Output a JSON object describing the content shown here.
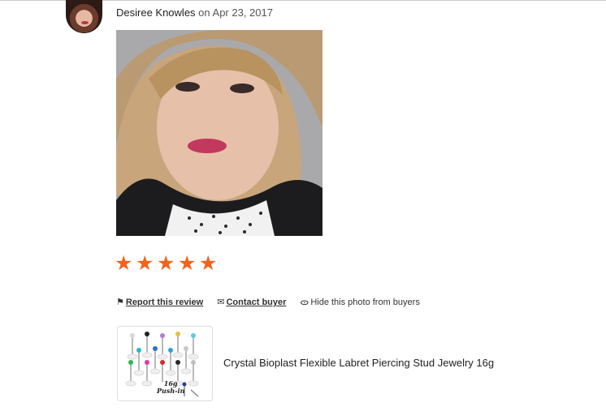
{
  "review": {
    "reviewer_name": "Desiree Knowles",
    "date_text": "on Apr 23, 2017",
    "rating": 5,
    "star_color": "#f1641e"
  },
  "actions": {
    "report_label": "Report this review",
    "contact_label": "Contact buyer",
    "hide_photo_label": "Hide this photo from buyers"
  },
  "product": {
    "title": "Crystal Bioplast Flexible Labret Piercing Stud Jewelry 16g",
    "thumb_caption_line1": "16g",
    "thumb_caption_line2": "Push-in"
  },
  "icons": {
    "report": "flag-icon",
    "contact": "message-icon",
    "hide": "hidden-eye-icon",
    "star": "star-icon"
  }
}
